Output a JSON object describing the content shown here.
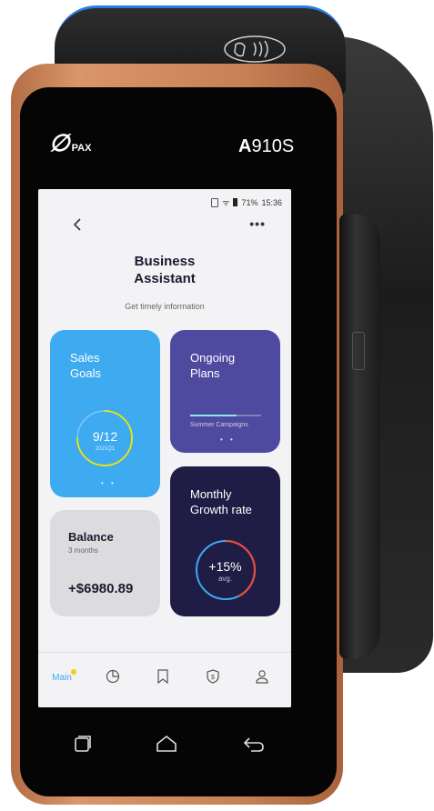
{
  "device": {
    "brand": "PAX",
    "model_bold": "A",
    "model_rest": "910S"
  },
  "status_bar": {
    "battery": "71%",
    "time": "15:36"
  },
  "header": {
    "back_icon": "chevron-left-icon",
    "more_icon": "more-horizontal-icon",
    "title_line1": "Business",
    "title_line2": "Assistant",
    "subtitle": "Get timely information"
  },
  "cards": {
    "sales": {
      "title_line1": "Sales",
      "title_line2": "Goals",
      "value": "9/12",
      "period": "2021Q1",
      "progress": 0.75,
      "ring_color": "#f5e400",
      "dots": "• •"
    },
    "plans": {
      "title_line1": "Ongoing",
      "title_line2": "Plans",
      "campaign": "Summer Campaigns",
      "progress": 0.65,
      "dots": "• •"
    },
    "growth": {
      "title_line1": "Monthly",
      "title_line2": "Growth rate",
      "value": "+15%",
      "note": "avg.",
      "ring_colors": [
        "#e84b3c",
        "#3eaaf0"
      ]
    },
    "balance": {
      "title": "Balance",
      "subtitle": "3 months",
      "amount": "+$6980.89"
    }
  },
  "nav": {
    "main_label": "Main",
    "items": [
      "pie-chart-icon",
      "bookmark-icon",
      "shield-dollar-icon",
      "user-icon"
    ]
  },
  "colors": {
    "accent": "#3eaaf0",
    "plans": "#4e4aa0",
    "growth": "#1f1d45",
    "balance": "#dcdcde",
    "device_body": "#c78055"
  }
}
